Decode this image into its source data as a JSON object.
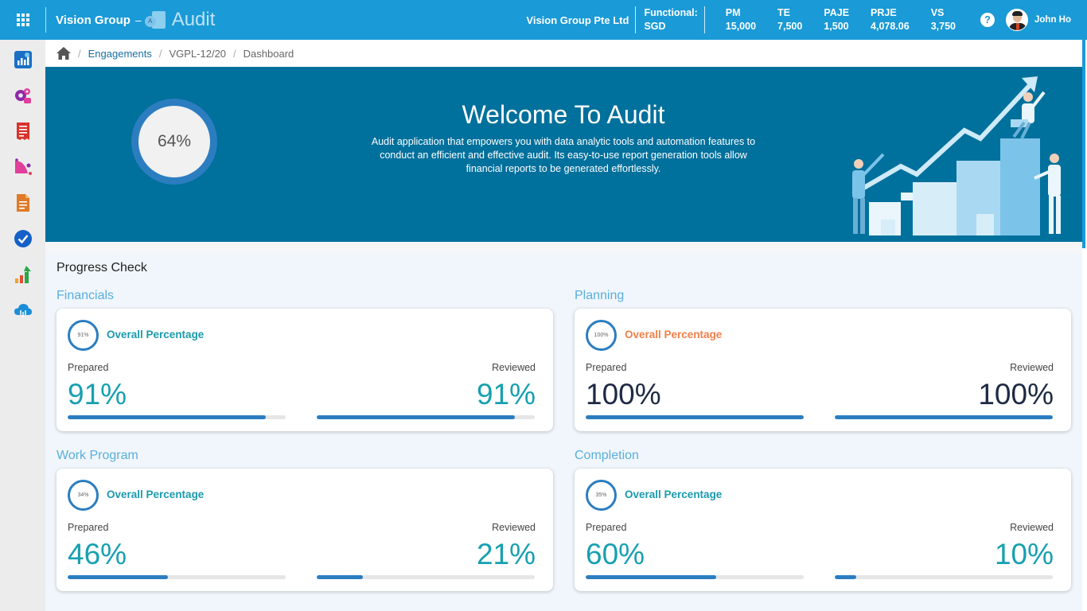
{
  "header": {
    "org_name": "Vision Group",
    "dash": "–",
    "app_name": "Audit",
    "logo_letter": "A",
    "company": "Vision Group Pte Ltd",
    "functional_label": "Functional:",
    "functional_value": "SGD",
    "metrics": [
      {
        "label": "PM",
        "value": "15,000"
      },
      {
        "label": "TE",
        "value": "7,500"
      },
      {
        "label": "PAJE",
        "value": "1,500"
      },
      {
        "label": "PRJE",
        "value": "4,078.06"
      },
      {
        "label": "VS",
        "value": "3,750"
      }
    ],
    "help_glyph": "?",
    "user_name": "John Ho"
  },
  "sidebar": {
    "items": [
      {
        "icon": "dashboard-chart-icon"
      },
      {
        "icon": "settings-gears-icon"
      },
      {
        "icon": "receipt-icon"
      },
      {
        "icon": "analytics-icon"
      },
      {
        "icon": "document-icon"
      },
      {
        "icon": "checkmark-icon"
      },
      {
        "icon": "growth-arrow-icon"
      },
      {
        "icon": "cloud-icon"
      }
    ]
  },
  "breadcrumb": {
    "items": [
      "Engagements",
      "VGPL-12/20",
      "Dashboard"
    ],
    "separator": "/"
  },
  "banner": {
    "overall_percent": "64%",
    "title": "Welcome To Audit",
    "description": "Audit application that empowers you with data analytic tools and automation features to conduct an efficient and effective audit. Its easy-to-use report generation tools allow financial reports to be generated effortlessly."
  },
  "progress": {
    "title": "Progress Check",
    "sections": [
      {
        "name": "Financials",
        "overall_label": "Overall Percentage",
        "overall_value": "91%",
        "prepared_label": "Prepared",
        "reviewed_label": "Reviewed",
        "prepared_value": "91%",
        "reviewed_value": "91%",
        "prepared_fraction": 0.91,
        "reviewed_fraction": 0.91
      },
      {
        "name": "Planning",
        "overall_label": "Overall Percentage",
        "overall_value": "100%",
        "prepared_label": "Prepared",
        "reviewed_label": "Reviewed",
        "prepared_value": "100%",
        "reviewed_value": "100%",
        "prepared_fraction": 1.0,
        "reviewed_fraction": 1.0
      },
      {
        "name": "Work Program",
        "overall_label": "Overall Percentage",
        "overall_value": "34%",
        "prepared_label": "Prepared",
        "reviewed_label": "Reviewed",
        "prepared_value": "46%",
        "reviewed_value": "21%",
        "prepared_fraction": 0.46,
        "reviewed_fraction": 0.21
      },
      {
        "name": "Completion",
        "overall_label": "Overall Percentage",
        "overall_value": "35%",
        "prepared_label": "Prepared",
        "reviewed_label": "Reviewed",
        "prepared_value": "60%",
        "reviewed_value": "10%",
        "prepared_fraction": 0.6,
        "reviewed_fraction": 0.1
      }
    ]
  },
  "colors": {
    "topbar": "#1a9ad6",
    "banner": "#00709c",
    "accent_teal": "#17a0b0",
    "accent_orange": "#f2804a",
    "bar_fill": "#2b7dc0",
    "section_label": "#5aaedc"
  }
}
